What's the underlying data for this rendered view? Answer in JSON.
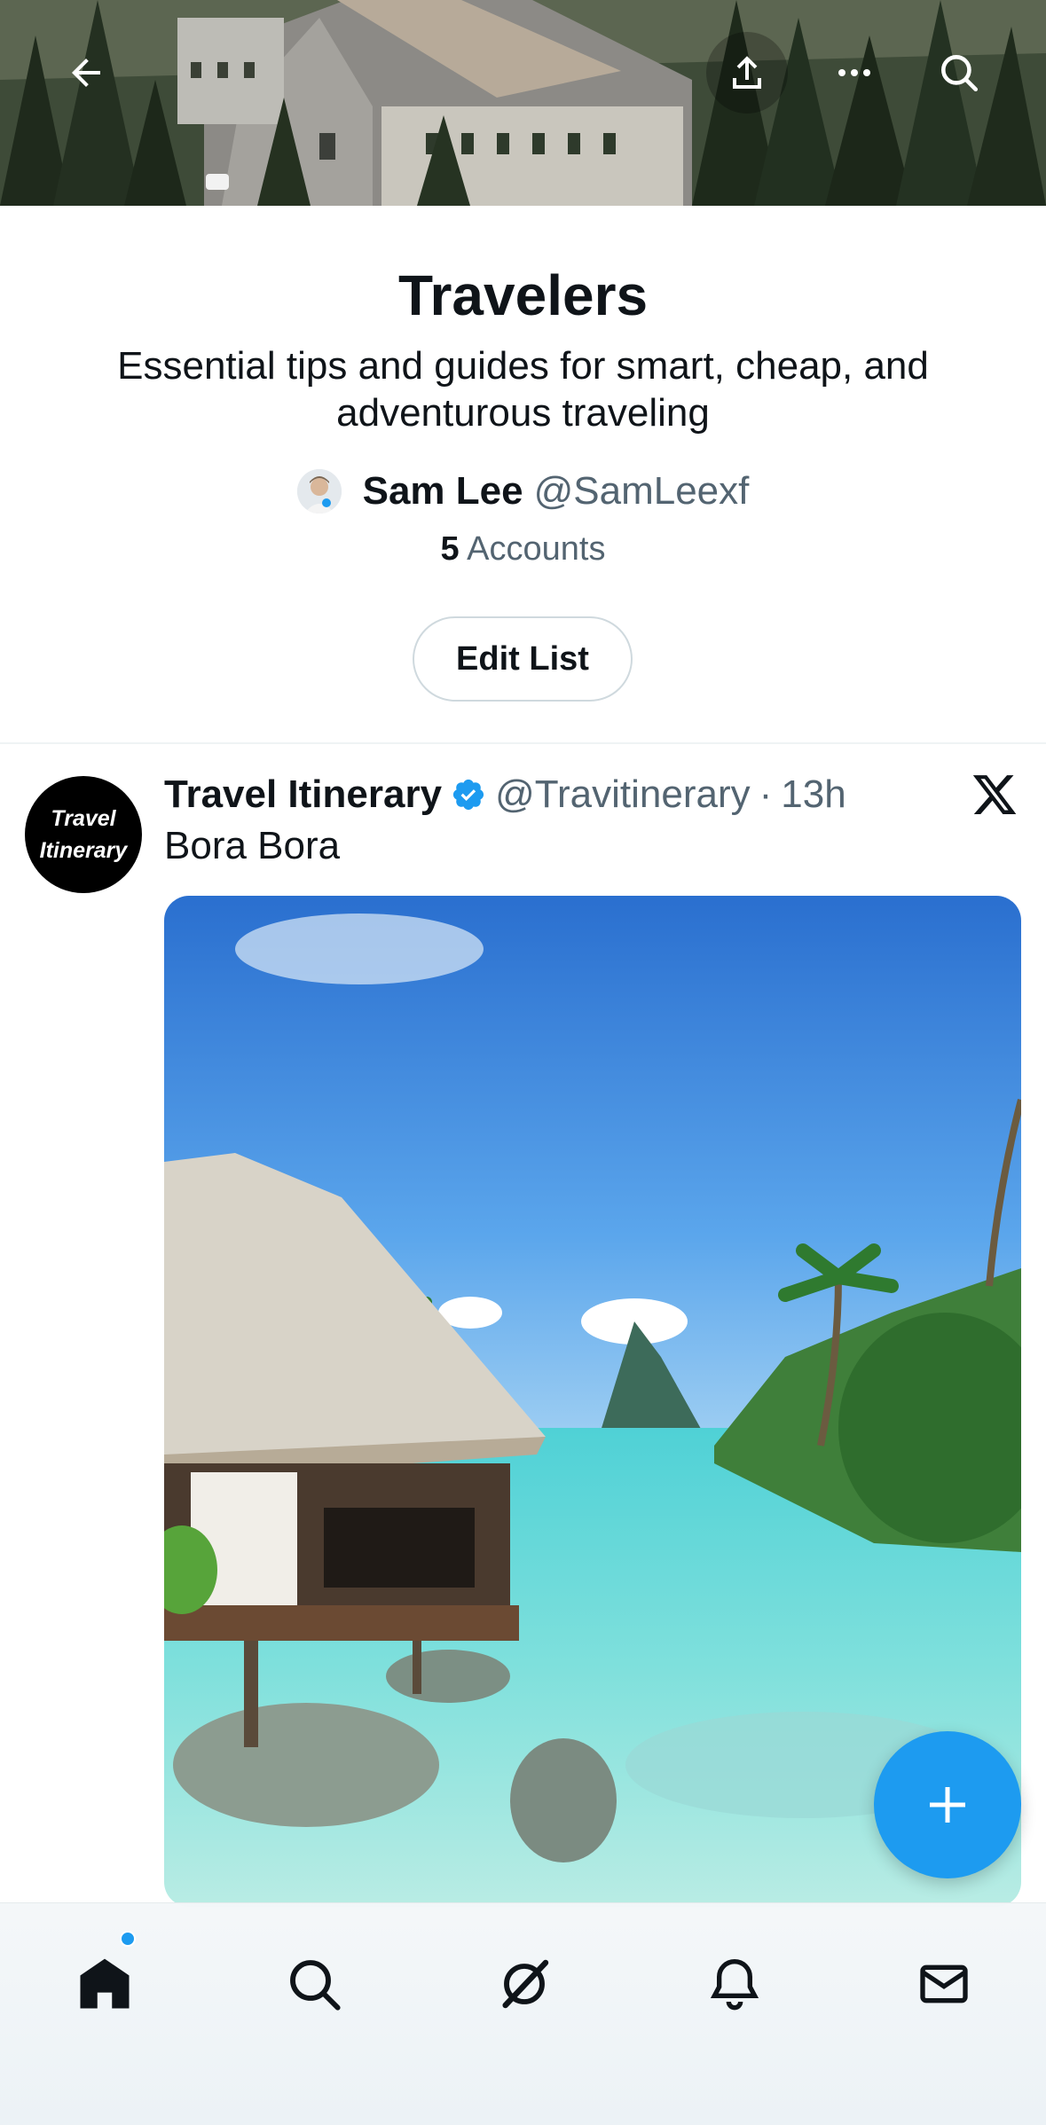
{
  "header": {
    "back_icon": "arrow-left-icon",
    "share_icon": "share-icon",
    "more_icon": "more-dots-icon",
    "search_icon": "search-icon"
  },
  "list": {
    "title": "Travelers",
    "description": "Essential tips and guides for smart, cheap, and adventurous traveling",
    "owner_name": "Sam Lee",
    "owner_handle": "@SamLeexf",
    "accounts_count": "5",
    "accounts_label": "Accounts",
    "edit_button": "Edit List"
  },
  "tweet": {
    "avatar_line1": "Travel",
    "avatar_line2": "Itinerary",
    "name": "Travel Itinerary",
    "handle": "@Travitinerary",
    "separator": "·",
    "time": "13h",
    "text": "Bora Bora",
    "verified": true
  },
  "fab": {
    "icon": "plus-icon"
  },
  "bottom_nav": {
    "items": [
      "home-icon",
      "search-icon",
      "grok-icon",
      "notifications-icon",
      "messages-icon"
    ],
    "home_has_badge": true
  },
  "colors": {
    "accent": "#1d9bf0",
    "text_primary": "#0f1419",
    "text_secondary": "#536471"
  }
}
